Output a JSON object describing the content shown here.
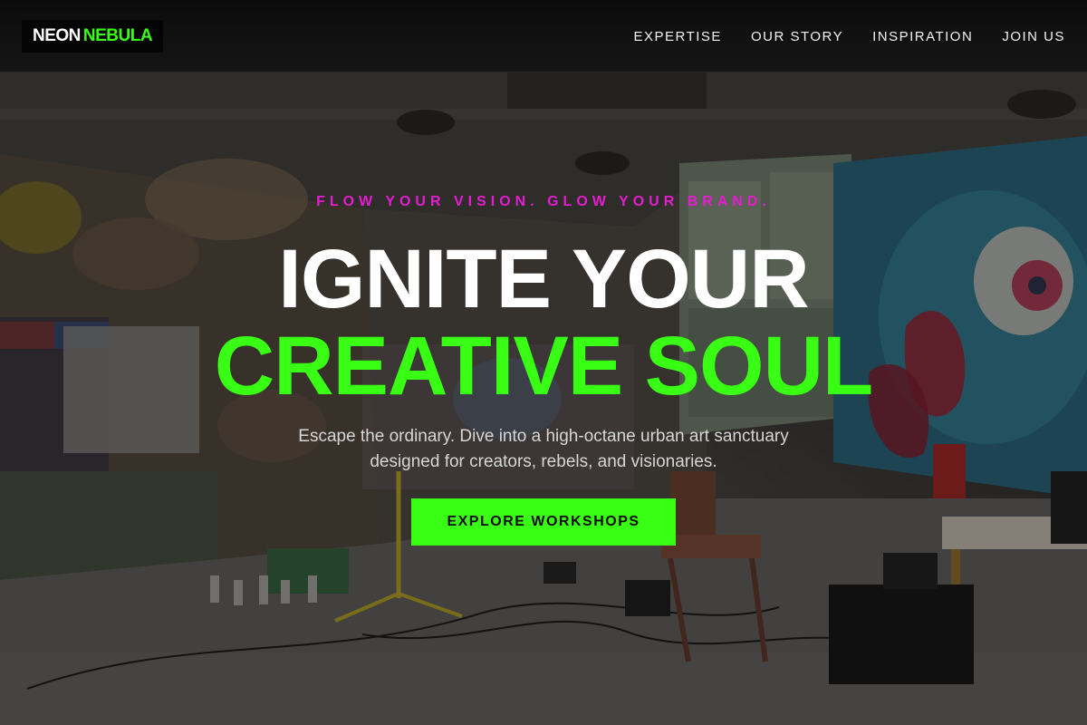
{
  "brand": {
    "part1": "NEON",
    "part2": "NEBULA",
    "accent": "#39ff14"
  },
  "nav": {
    "items": [
      {
        "label": "EXPERTISE"
      },
      {
        "label": "OUR STORY"
      },
      {
        "label": "INSPIRATION"
      },
      {
        "label": "JOIN US"
      }
    ]
  },
  "hero": {
    "tagline": "FLOW YOUR VISION. GLOW YOUR BRAND.",
    "title_line1": "IGNITE YOUR",
    "title_line2": "CREATIVE SOUL",
    "subtitle": "Escape the ordinary. Dive into a high-octane urban art sanctuary designed for creators, rebels, and visionaries.",
    "cta_label": "EXPLORE WORKSHOPS",
    "colors": {
      "tagline": "#e61cd0",
      "title_accent": "#39ff14",
      "button": "#39ff14"
    }
  }
}
